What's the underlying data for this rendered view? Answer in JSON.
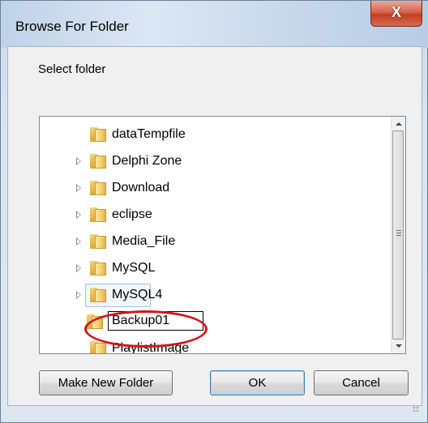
{
  "window": {
    "title": "Browse For Folder",
    "close_label": "X"
  },
  "dialog": {
    "description": "Select folder"
  },
  "tree": {
    "items": [
      {
        "label": "dataTempfile",
        "expander": false
      },
      {
        "label": "Delphi Zone",
        "expander": true
      },
      {
        "label": "Download",
        "expander": true
      },
      {
        "label": "eclipse",
        "expander": true
      },
      {
        "label": "Media_File",
        "expander": true
      },
      {
        "label": "MySQL",
        "expander": true
      },
      {
        "label": "MySQL4",
        "expander": true
      },
      {
        "label": "Backup01",
        "expander": false,
        "editing": true
      },
      {
        "label": "PlaylistImage",
        "expander": false
      }
    ]
  },
  "buttons": {
    "make_new_folder": "Make New Folder",
    "ok": "OK",
    "cancel": "Cancel"
  },
  "colors": {
    "highlight_ellipse": "#d4141a",
    "close_button": "#c23f25"
  }
}
